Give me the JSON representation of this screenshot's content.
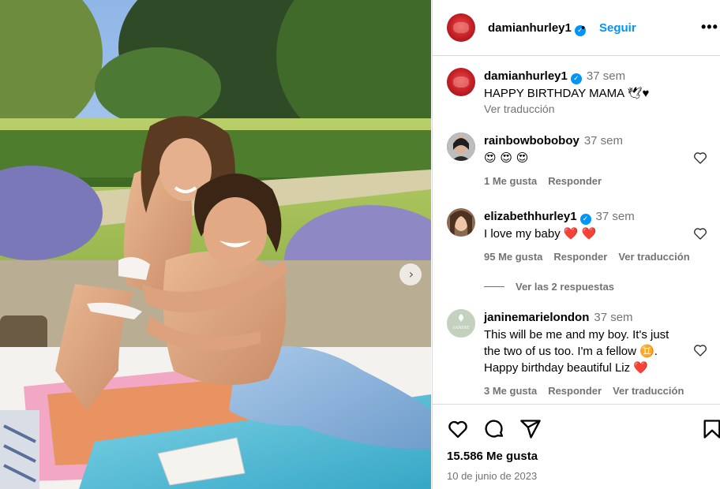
{
  "photo": {
    "alt_subjects": [
      "woman in bikini hugging young man on picnic blanket in garden"
    ]
  },
  "header": {
    "username": "damianhurley1",
    "verified_mark": "✓",
    "separator": "•",
    "follow_label": "Seguir",
    "more_label": "•••"
  },
  "caption": {
    "username": "damianhurley1",
    "time": "37 sem",
    "text": "HAPPY BIRTHDAY MAMA 🕊♥",
    "translate": "Ver traducción"
  },
  "comments": [
    {
      "username": "rainbowboboboy",
      "time": "37 sem",
      "text": "😍 😍 😍",
      "likes": "1 Me gusta",
      "reply": "Responder",
      "translate": ""
    },
    {
      "username": "elizabethhurley1",
      "time": "37 sem",
      "text": "I love my baby ❤️ ❤️",
      "likes": "95 Me gusta",
      "reply": "Responder",
      "translate": "Ver traducción",
      "view_replies": "Ver las 2 respuestas"
    },
    {
      "username": "janinemarielondon",
      "time": "37 sem",
      "text_lines": [
        "This will be me and my boy. It's just",
        "the two of us too. I'm a fellow ♊.",
        "Happy birthday beautiful Liz ❤️"
      ],
      "likes": "3 Me gusta",
      "reply": "Responder",
      "translate": "Ver traducción",
      "avatar_text": "JANINE"
    }
  ],
  "footer": {
    "likes": "15.586 Me gusta",
    "date": "10 de junio de 2023"
  },
  "icons": [
    "heart-icon",
    "comment-icon",
    "share-icon",
    "bookmark-icon",
    "chevron-right-icon",
    "verified-icon",
    "more-icon"
  ],
  "colors": {
    "link_blue": "#0095f6",
    "muted_gray": "#737373",
    "border": "#dbdbdb",
    "heart_red": "#e0162b"
  }
}
